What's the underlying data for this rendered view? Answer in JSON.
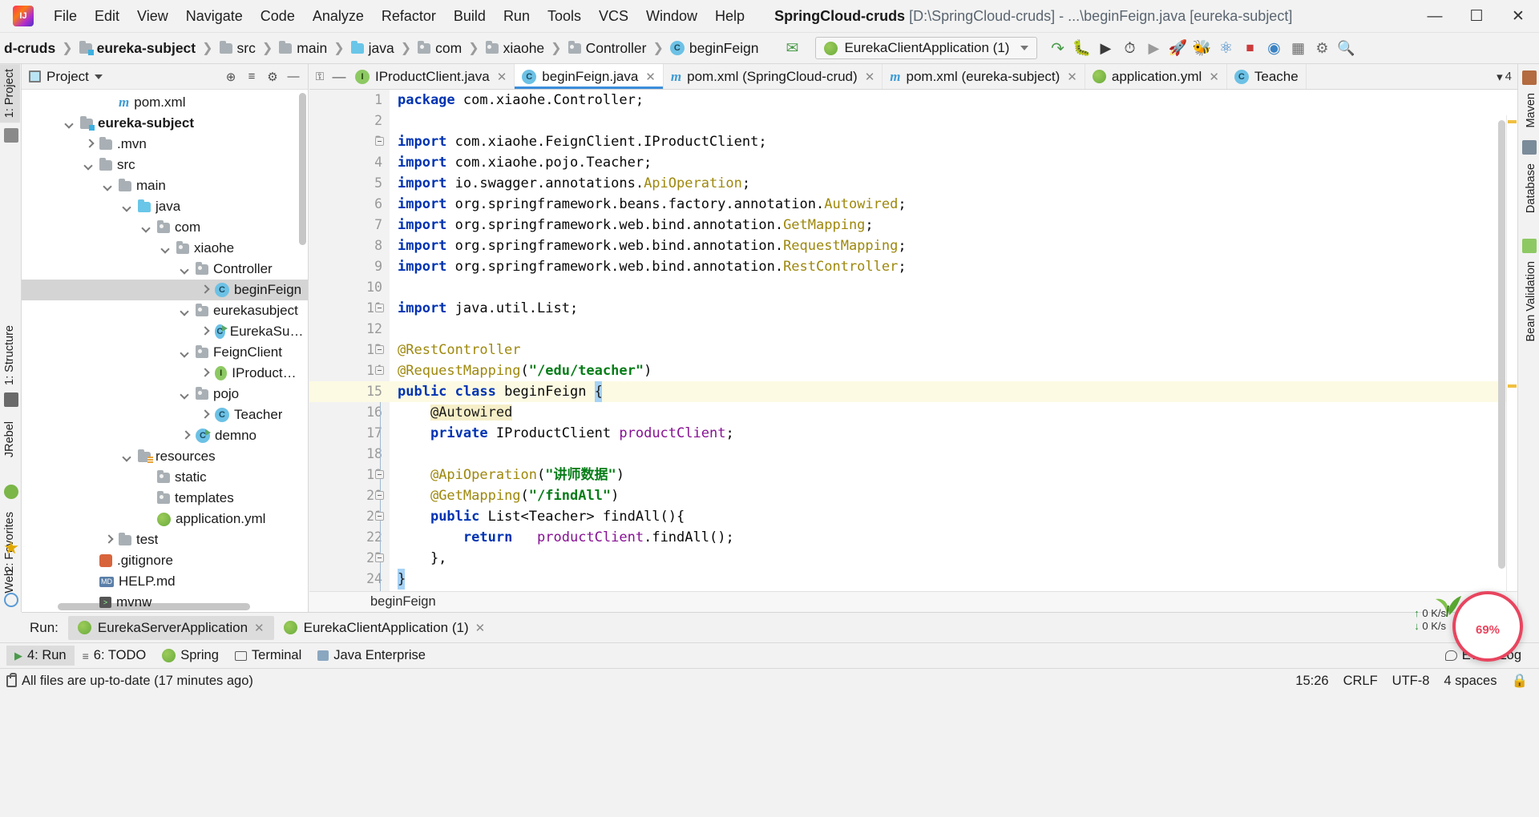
{
  "window": {
    "project_name": "SpringCloud-cruds",
    "path_suffix": "[D:\\SpringCloud-cruds] - ...\\beginFeign.java [eureka-subject]",
    "minimize": "—",
    "maximize": "☐",
    "close": "✕"
  },
  "menu": [
    {
      "label": "File"
    },
    {
      "label": "Edit"
    },
    {
      "label": "View"
    },
    {
      "label": "Navigate"
    },
    {
      "label": "Code"
    },
    {
      "label": "Analyze"
    },
    {
      "label": "Refactor"
    },
    {
      "label": "Build"
    },
    {
      "label": "Run"
    },
    {
      "label": "Tools"
    },
    {
      "label": "VCS"
    },
    {
      "label": "Window"
    },
    {
      "label": "Help"
    }
  ],
  "breadcrumbs": [
    {
      "label": "d-cruds",
      "icon": "none",
      "bold": true
    },
    {
      "label": "eureka-subject",
      "icon": "module-folder-icon",
      "bold": true
    },
    {
      "label": "src",
      "icon": "folder-icon",
      "bold": false
    },
    {
      "label": "main",
      "icon": "folder-icon",
      "bold": false
    },
    {
      "label": "java",
      "icon": "source-folder-icon",
      "bold": false
    },
    {
      "label": "com",
      "icon": "package-folder-icon",
      "bold": false
    },
    {
      "label": "xiaohe",
      "icon": "package-folder-icon",
      "bold": false
    },
    {
      "label": "Controller",
      "icon": "package-folder-icon",
      "bold": false
    },
    {
      "label": "beginFeign",
      "icon": "class-icon",
      "bold": false
    }
  ],
  "toolbar": {
    "build_icon": "hammer-icon",
    "run_config": "EurekaClientApplication (1)",
    "run_config_dropdown": "chevron-down-icon",
    "icons": [
      {
        "name": "rerun-icon",
        "glyph": "↻"
      },
      {
        "name": "debug-icon",
        "glyph": "🐞"
      },
      {
        "name": "run-with-coverage-icon",
        "glyph": "▷"
      },
      {
        "name": "profile-icon",
        "glyph": "⏱"
      },
      {
        "name": "run-icon",
        "glyph": "▶"
      },
      {
        "name": "jrebel-run-icon",
        "glyph": "🚀"
      },
      {
        "name": "jrebel-debug-icon",
        "glyph": "🐛"
      },
      {
        "name": "update-app-icon",
        "glyph": "⟳"
      },
      {
        "name": "stop-icon",
        "glyph": "■"
      },
      {
        "name": "jrebel-monitor-icon",
        "glyph": "◎"
      },
      {
        "name": "project-structure-icon",
        "glyph": "▤"
      },
      {
        "name": "settings-icon",
        "glyph": "⚙"
      },
      {
        "name": "search-icon",
        "glyph": "🔍"
      }
    ]
  },
  "left_strip": [
    {
      "label": "1: Project",
      "selected": true
    },
    {
      "label": "1: Structure",
      "selected": false
    },
    {
      "label": "JRebel",
      "selected": false
    },
    {
      "label": "2: Favorites",
      "selected": false
    },
    {
      "label": "Web",
      "selected": false
    }
  ],
  "right_strip": [
    {
      "label": "Maven",
      "selected": false
    },
    {
      "label": "Database",
      "selected": false
    },
    {
      "label": "Bean Validation",
      "selected": false
    }
  ],
  "project_panel": {
    "title": "Project",
    "dropdown_icon": "chevron-down-icon",
    "actions": [
      {
        "name": "locate-icon",
        "glyph": "⊕"
      },
      {
        "name": "collapse-all-icon",
        "glyph": "≡"
      },
      {
        "name": "settings-icon",
        "glyph": "⚙"
      },
      {
        "name": "hide-icon",
        "glyph": "—"
      }
    ],
    "tree": [
      {
        "label": "pom.xml",
        "indent": 4,
        "arrow": "none",
        "icon": "maven-icon",
        "bold": false,
        "selected": false
      },
      {
        "label": "eureka-subject",
        "indent": 2,
        "arrow": "down",
        "icon": "module-folder-icon",
        "bold": true,
        "selected": false
      },
      {
        "label": ".mvn",
        "indent": 3,
        "arrow": "right",
        "icon": "folder-icon",
        "bold": false,
        "selected": false
      },
      {
        "label": "src",
        "indent": 3,
        "arrow": "down",
        "icon": "folder-icon",
        "bold": false,
        "selected": false
      },
      {
        "label": "main",
        "indent": 4,
        "arrow": "down",
        "icon": "folder-icon",
        "bold": false,
        "selected": false
      },
      {
        "label": "java",
        "indent": 5,
        "arrow": "down",
        "icon": "source-folder-icon",
        "bold": false,
        "selected": false
      },
      {
        "label": "com",
        "indent": 6,
        "arrow": "down",
        "icon": "package-folder-icon",
        "bold": false,
        "selected": false
      },
      {
        "label": "xiaohe",
        "indent": 7,
        "arrow": "down",
        "icon": "package-folder-icon",
        "bold": false,
        "selected": false
      },
      {
        "label": "Controller",
        "indent": 8,
        "arrow": "down",
        "icon": "package-folder-icon",
        "bold": false,
        "selected": false
      },
      {
        "label": "beginFeign",
        "indent": 9,
        "arrow": "right",
        "icon": "class-icon",
        "bold": false,
        "selected": true
      },
      {
        "label": "eurekasubject",
        "indent": 8,
        "arrow": "down",
        "icon": "package-folder-icon",
        "bold": false,
        "selected": false
      },
      {
        "label": "EurekaSubjectAp",
        "indent": 9,
        "arrow": "right",
        "icon": "runnable-class-icon",
        "bold": false,
        "selected": false
      },
      {
        "label": "FeignClient",
        "indent": 8,
        "arrow": "down",
        "icon": "package-folder-icon",
        "bold": false,
        "selected": false
      },
      {
        "label": "IProductClient",
        "indent": 9,
        "arrow": "right",
        "icon": "interface-icon",
        "bold": false,
        "selected": false
      },
      {
        "label": "pojo",
        "indent": 8,
        "arrow": "down",
        "icon": "package-folder-icon",
        "bold": false,
        "selected": false
      },
      {
        "label": "Teacher",
        "indent": 9,
        "arrow": "right",
        "icon": "class-icon",
        "bold": false,
        "selected": false
      },
      {
        "label": "demno",
        "indent": 8,
        "arrow": "right",
        "icon": "runnable-class-icon",
        "bold": false,
        "selected": false
      },
      {
        "label": "resources",
        "indent": 5,
        "arrow": "down",
        "icon": "resource-folder-icon",
        "bold": false,
        "selected": false
      },
      {
        "label": "static",
        "indent": 6,
        "arrow": "none",
        "icon": "package-folder-icon",
        "bold": false,
        "selected": false
      },
      {
        "label": "templates",
        "indent": 6,
        "arrow": "none",
        "icon": "package-folder-icon",
        "bold": false,
        "selected": false
      },
      {
        "label": "application.yml",
        "indent": 6,
        "arrow": "none",
        "icon": "yml-icon",
        "bold": false,
        "selected": false
      },
      {
        "label": "test",
        "indent": 4,
        "arrow": "right",
        "icon": "folder-icon",
        "bold": false,
        "selected": false
      },
      {
        "label": ".gitignore",
        "indent": 3,
        "arrow": "none",
        "icon": "git-icon",
        "bold": false,
        "selected": false
      },
      {
        "label": "HELP.md",
        "indent": 3,
        "arrow": "none",
        "icon": "md-icon",
        "bold": false,
        "selected": false
      },
      {
        "label": "mvnw",
        "indent": 3,
        "arrow": "none",
        "icon": "script-icon",
        "bold": false,
        "selected": false
      }
    ]
  },
  "editor": {
    "tabs": [
      {
        "label": "IProductClient.java",
        "icon": "interface-icon",
        "active": false,
        "close": "✕"
      },
      {
        "label": "beginFeign.java",
        "icon": "class-icon",
        "active": true,
        "close": "✕"
      },
      {
        "label": "pom.xml (SpringCloud-crud)",
        "icon": "maven-icon",
        "active": false,
        "close": "✕"
      },
      {
        "label": "pom.xml (eureka-subject)",
        "icon": "maven-icon",
        "active": false,
        "close": "✕"
      },
      {
        "label": "application.yml",
        "icon": "yml-icon",
        "active": false,
        "close": "✕"
      },
      {
        "label": "Teache",
        "icon": "class-icon",
        "active": false,
        "close": ""
      }
    ],
    "tab_overflow": "4",
    "breadcrumb_bottom": "beginFeign",
    "lines": [
      {
        "n": 1,
        "tokens": [
          {
            "t": "package ",
            "c": "kw"
          },
          {
            "t": "com.xiaohe.Controller;",
            "c": "pln"
          }
        ],
        "fold": "",
        "hl": false
      },
      {
        "n": 2,
        "tokens": [],
        "fold": "",
        "hl": false
      },
      {
        "n": 3,
        "tokens": [
          {
            "t": "import ",
            "c": "kw"
          },
          {
            "t": "com.xiaohe.FeignClient.IProductClient;",
            "c": "pln"
          }
        ],
        "fold": "minus",
        "hl": false
      },
      {
        "n": 4,
        "tokens": [
          {
            "t": "import ",
            "c": "kw"
          },
          {
            "t": "com.xiaohe.pojo.Teacher;",
            "c": "pln"
          }
        ],
        "fold": "",
        "hl": false
      },
      {
        "n": 5,
        "tokens": [
          {
            "t": "import ",
            "c": "kw"
          },
          {
            "t": "io.swagger.annotations.",
            "c": "pln"
          },
          {
            "t": "ApiOperation",
            "c": "ann"
          },
          {
            "t": ";",
            "c": "pln"
          }
        ],
        "fold": "",
        "hl": false
      },
      {
        "n": 6,
        "tokens": [
          {
            "t": "import ",
            "c": "kw"
          },
          {
            "t": "org.springframework.beans.factory.annotation.",
            "c": "pln"
          },
          {
            "t": "Autowired",
            "c": "ann"
          },
          {
            "t": ";",
            "c": "pln"
          }
        ],
        "fold": "",
        "hl": false
      },
      {
        "n": 7,
        "tokens": [
          {
            "t": "import ",
            "c": "kw"
          },
          {
            "t": "org.springframework.web.bind.annotation.",
            "c": "pln"
          },
          {
            "t": "GetMapping",
            "c": "ann"
          },
          {
            "t": ";",
            "c": "pln"
          }
        ],
        "fold": "",
        "hl": false
      },
      {
        "n": 8,
        "tokens": [
          {
            "t": "import ",
            "c": "kw"
          },
          {
            "t": "org.springframework.web.bind.annotation.",
            "c": "pln"
          },
          {
            "t": "RequestMapping",
            "c": "ann"
          },
          {
            "t": ";",
            "c": "pln"
          }
        ],
        "fold": "",
        "hl": false
      },
      {
        "n": 9,
        "tokens": [
          {
            "t": "import ",
            "c": "kw"
          },
          {
            "t": "org.springframework.web.bind.annotation.",
            "c": "pln"
          },
          {
            "t": "RestController",
            "c": "ann"
          },
          {
            "t": ";",
            "c": "pln"
          }
        ],
        "fold": "",
        "hl": false
      },
      {
        "n": 10,
        "tokens": [],
        "fold": "",
        "hl": false
      },
      {
        "n": 11,
        "tokens": [
          {
            "t": "import ",
            "c": "kw"
          },
          {
            "t": "java.util.List;",
            "c": "pln"
          }
        ],
        "fold": "minus",
        "hl": false
      },
      {
        "n": 12,
        "tokens": [],
        "fold": "",
        "hl": false
      },
      {
        "n": 13,
        "tokens": [
          {
            "t": "@RestController",
            "c": "ann"
          }
        ],
        "fold": "minus",
        "hl": false
      },
      {
        "n": 14,
        "tokens": [
          {
            "t": "@RequestMapping",
            "c": "ann"
          },
          {
            "t": "(",
            "c": "pln"
          },
          {
            "t": "\"/edu/teacher\"",
            "c": "str"
          },
          {
            "t": ")",
            "c": "pln"
          }
        ],
        "fold": "minus",
        "hl": false
      },
      {
        "n": 15,
        "tokens": [
          {
            "t": "public ",
            "c": "kw"
          },
          {
            "t": "class ",
            "c": "kw"
          },
          {
            "t": "beginFeign ",
            "c": "pln"
          },
          {
            "t": "{",
            "c": "caret"
          }
        ],
        "fold": "",
        "hl": true
      },
      {
        "n": 16,
        "tokens": [
          {
            "t": "    ",
            "c": "pln"
          },
          {
            "t": "@Autowired",
            "c": "annhl"
          }
        ],
        "fold": "",
        "hl": false
      },
      {
        "n": 17,
        "tokens": [
          {
            "t": "    ",
            "c": "pln"
          },
          {
            "t": "private ",
            "c": "kw"
          },
          {
            "t": "IProductClient ",
            "c": "pln"
          },
          {
            "t": "productClient",
            "c": "fld"
          },
          {
            "t": ";",
            "c": "pln"
          }
        ],
        "fold": "",
        "hl": false
      },
      {
        "n": 18,
        "tokens": [],
        "fold": "",
        "hl": false
      },
      {
        "n": 19,
        "tokens": [
          {
            "t": "    ",
            "c": "pln"
          },
          {
            "t": "@ApiOperation",
            "c": "ann"
          },
          {
            "t": "(",
            "c": "pln"
          },
          {
            "t": "\"讲师数据\"",
            "c": "str"
          },
          {
            "t": ")",
            "c": "pln"
          }
        ],
        "fold": "minus",
        "hl": false
      },
      {
        "n": 20,
        "tokens": [
          {
            "t": "    ",
            "c": "pln"
          },
          {
            "t": "@GetMapping",
            "c": "ann"
          },
          {
            "t": "(",
            "c": "pln"
          },
          {
            "t": "\"/findAll\"",
            "c": "str"
          },
          {
            "t": ")",
            "c": "pln"
          }
        ],
        "fold": "minus",
        "hl": false
      },
      {
        "n": 21,
        "tokens": [
          {
            "t": "    ",
            "c": "pln"
          },
          {
            "t": "public ",
            "c": "kw"
          },
          {
            "t": "List<Teacher> findAll(){",
            "c": "pln"
          }
        ],
        "fold": "minus",
        "hl": false
      },
      {
        "n": 22,
        "tokens": [
          {
            "t": "        ",
            "c": "pln"
          },
          {
            "t": "return ",
            "c": "kw"
          },
          {
            "t": "  ",
            "c": "pln"
          },
          {
            "t": "productClient",
            "c": "fld"
          },
          {
            "t": ".findAll();",
            "c": "pln"
          }
        ],
        "fold": "",
        "hl": false
      },
      {
        "n": 23,
        "tokens": [
          {
            "t": "    },",
            "c": "pln"
          }
        ],
        "fold": "minus",
        "hl": false
      },
      {
        "n": 24,
        "tokens": [
          {
            "t": "}",
            "c": "caret"
          }
        ],
        "fold": "",
        "hl": false
      }
    ]
  },
  "run_panel": {
    "label": "Run:",
    "tabs": [
      {
        "label": "EurekaServerApplication",
        "selected": true,
        "close": "✕",
        "icon": "spring-run-icon"
      },
      {
        "label": "EurekaClientApplication (1)",
        "selected": false,
        "close": "✕",
        "icon": "spring-run-icon"
      }
    ]
  },
  "bottom_toolwindows": [
    {
      "label": "4: Run",
      "icon": "run-icon",
      "selected": true,
      "prefix": "▶"
    },
    {
      "label": "6: TODO",
      "icon": "todo-icon",
      "selected": false,
      "prefix": "≡"
    },
    {
      "label": "Spring",
      "icon": "spring-icon",
      "selected": false,
      "prefix": ""
    },
    {
      "label": "Terminal",
      "icon": "terminal-icon",
      "selected": false,
      "prefix": ""
    },
    {
      "label": "Java Enterprise",
      "icon": "java-ee-icon",
      "selected": false,
      "prefix": ""
    }
  ],
  "bottom_right": {
    "event_log": "Event Log",
    "event_log_icon": "balloon-icon"
  },
  "status_bar": {
    "message": "All files are up-to-date (17 minutes ago)",
    "lock_icon": "lock-icon",
    "time": "15:26",
    "line_separator": "CRLF",
    "encoding": "UTF-8",
    "indent": "4 spaces"
  },
  "cpu_widget": {
    "percent": "69",
    "unit": "%",
    "upload": "0",
    "download": "0",
    "rate_unit": "K/s",
    "color": "#e8455f"
  }
}
